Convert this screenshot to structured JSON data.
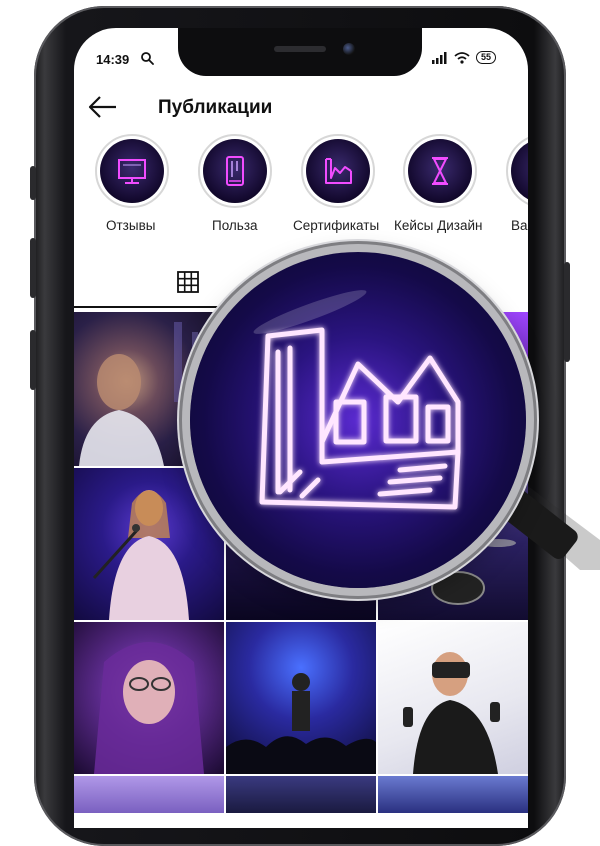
{
  "status_bar": {
    "time": "14:39",
    "battery": "55"
  },
  "header": {
    "title": "Публикации"
  },
  "highlights": [
    {
      "label": "Отзывы",
      "icon": "monitor-icon"
    },
    {
      "label": "Польза",
      "icon": "phone-icon"
    },
    {
      "label": "Сертификаты",
      "icon": "factory-icon"
    },
    {
      "label": "Кейсы Дизайн",
      "icon": "hourglass-icon"
    },
    {
      "label": "Ва",
      "icon": "partial-icon"
    }
  ],
  "tabs": {
    "active": "grid-icon"
  },
  "colors": {
    "neon": "#e83cff",
    "accent": "#7b3cff",
    "dark": "#0d0d0f"
  },
  "photos": [
    "portrait-man-glasses",
    "club-lights",
    "neon-light",
    "singer-microphone",
    "concert-stage",
    "drum-kit",
    "girl-purple-hair",
    "band-concert",
    "vr-headset",
    "girl-blonde",
    "lights-top",
    "stage-lights"
  ]
}
